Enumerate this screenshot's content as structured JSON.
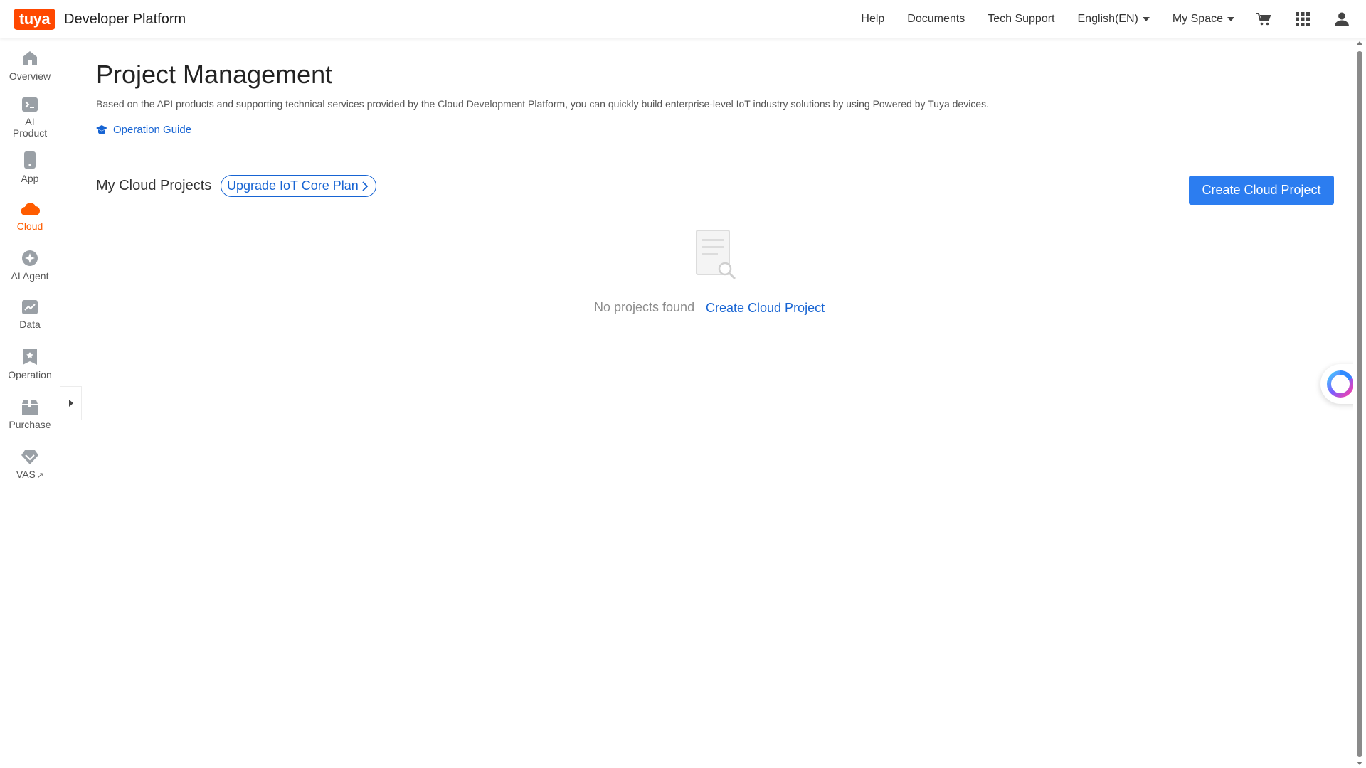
{
  "header": {
    "logo_text": "tuya",
    "title": "Developer Platform",
    "nav": [
      {
        "label": "Help"
      },
      {
        "label": "Documents"
      },
      {
        "label": "Tech Support"
      },
      {
        "label": "English(EN)",
        "dropdown": true
      },
      {
        "label": "My Space",
        "dropdown": true
      }
    ],
    "icons": [
      "cart-icon",
      "apps-grid-icon",
      "user-icon"
    ]
  },
  "sidebar": {
    "items": [
      {
        "id": "overview",
        "label": "Overview",
        "icon": "home-icon"
      },
      {
        "id": "ai-product",
        "label": "AI Product",
        "icon": "terminal-icon"
      },
      {
        "id": "app",
        "label": "App",
        "icon": "phone-icon"
      },
      {
        "id": "cloud",
        "label": "Cloud",
        "icon": "cloud-icon",
        "active": true
      },
      {
        "id": "ai-agent",
        "label": "AI Agent",
        "icon": "sparkle-icon"
      },
      {
        "id": "data",
        "label": "Data",
        "icon": "chart-icon"
      },
      {
        "id": "operation",
        "label": "Operation",
        "icon": "bookmark-icon"
      },
      {
        "id": "purchase",
        "label": "Purchase",
        "icon": "box-icon"
      },
      {
        "id": "vas",
        "label": "VAS",
        "icon": "diamond-icon",
        "external": true
      }
    ]
  },
  "main": {
    "title": "Project Management",
    "description": "Based on the API products and supporting technical services provided by the Cloud Development Platform, you can quickly build enterprise-level IoT industry solutions by using Powered by Tuya devices.",
    "guide_label": "Operation Guide",
    "section_title": "My Cloud Projects",
    "upgrade_label": "Upgrade IoT Core Plan",
    "create_button_label": "Create Cloud Project",
    "empty": {
      "text": "No projects found",
      "link_label": "Create Cloud Project"
    }
  },
  "colors": {
    "brand": "#ff4800",
    "active": "#ff5c00",
    "link": "#1764d3",
    "primary_button": "#2c7df0"
  }
}
